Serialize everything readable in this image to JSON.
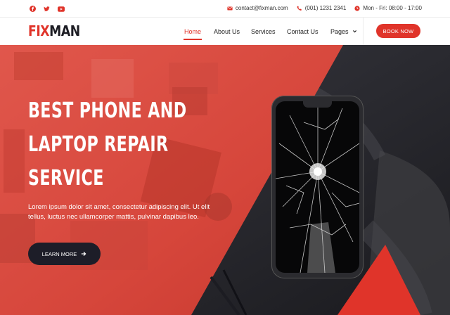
{
  "topbar": {
    "social": [
      {
        "icon": "facebook-icon"
      },
      {
        "icon": "twitter-icon"
      },
      {
        "icon": "youtube-icon"
      }
    ],
    "email": "contact@fixman.com",
    "phone": "(001) 1231 2341",
    "hours": "Mon - Fri: 08:00 - 17:00"
  },
  "brand": {
    "part1": "FIX",
    "part2": "MAN"
  },
  "nav": {
    "items": [
      {
        "label": "Home",
        "active": true
      },
      {
        "label": "About Us"
      },
      {
        "label": "Services"
      },
      {
        "label": "Contact Us"
      },
      {
        "label": "Pages",
        "dropdown": true
      }
    ],
    "book_label": "BOOK NOW"
  },
  "hero": {
    "title_lines": [
      "BEST PHONE AND",
      "LAPTOP REPAIR",
      "SERVICE"
    ],
    "description": "Lorem ipsum dolor sit amet, consectetur adipiscing elit. Ut elit tellus, luctus nec ullamcorper mattis, pulvinar dapibus leo.",
    "cta_label": "LEARN MORE"
  },
  "colors": {
    "accent": "#e0342a",
    "dark": "#1d1d28",
    "hero_red": "#d9463c"
  }
}
